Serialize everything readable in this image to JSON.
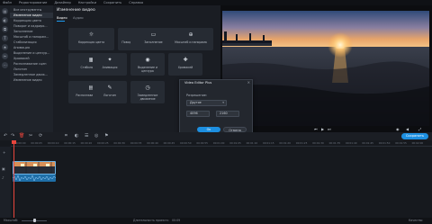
{
  "menu": [
    "Файл",
    "Редактирование",
    "Дизайнер",
    "Настройки",
    "Сохранить",
    "Справка"
  ],
  "rail_icons": [
    "import-icon",
    "filters-icon",
    "transitions-icon",
    "titles-icon",
    "stickers-icon",
    "tools-icon",
    "more-icon"
  ],
  "tools": {
    "items": [
      "Все инструменты",
      "Изменение видео",
      "Коррекция цвета",
      "Поворот и кадриро...",
      "Заполнение",
      "Масштаб и панорам...",
      "Стабилизация",
      "Анимация",
      "Выделение и цензур...",
      "Хромакей",
      "Распознавание сцен",
      "Логотип",
      "Замедленное движ...",
      "Изменение видео"
    ],
    "active_index": 1
  },
  "panel": {
    "title": "Изменение видео",
    "tabs": [
      "Видео",
      "Аудио"
    ],
    "active_tab": 0,
    "tiles": [
      {
        "icon": "☼",
        "label": "Коррекция цвета"
      },
      {
        "icon": "⟳",
        "label": "Поворот и кадрирование"
      },
      {
        "icon": "▭",
        "label": "Заполнение"
      },
      {
        "icon": "⊕",
        "label": "Масштаб и панорама"
      },
      {
        "icon": "▦",
        "label": "Стабилизация"
      },
      {
        "icon": "✦",
        "label": "Анимация"
      },
      {
        "icon": "◉",
        "label": "Выделение и цензура"
      },
      {
        "icon": "✚",
        "label": "Хромакей"
      },
      {
        "icon": "▤",
        "label": "Распознавание сцен"
      },
      {
        "icon": "✎",
        "label": "Логотип"
      },
      {
        "icon": "◷",
        "label": "Замедленное движение"
      }
    ]
  },
  "dialog": {
    "title": "Video Editor Plus",
    "close": "×",
    "resolution_label": "Разрешение:",
    "preset": "Другое",
    "width": "4096",
    "height": "2160",
    "ok": "Ок",
    "cancel": "Отмена"
  },
  "toolbar": {
    "export_label": "Сохранить"
  },
  "timeline": {
    "ticks": [
      "00:00:00",
      "00:00:05",
      "00:00:10",
      "00:00:15",
      "00:00:20",
      "00:00:25",
      "00:00:30",
      "00:00:35",
      "00:00:40",
      "00:00:45",
      "00:00:50",
      "00:00:55",
      "00:01:00",
      "00:01:05",
      "00:01:10",
      "00:01:15",
      "00:01:20",
      "00:01:25",
      "00:01:30",
      "00:01:35",
      "00:01:40",
      "00:01:45",
      "00:01:50",
      "00:01:55",
      "00:02:00"
    ]
  },
  "status": {
    "zoom": "Масштаб:",
    "duration_label": "Длительность проекта:",
    "duration": "00:09",
    "quality": "Качество"
  },
  "colors": {
    "accent": "#1d8fe0",
    "playhead": "#e8453c"
  }
}
